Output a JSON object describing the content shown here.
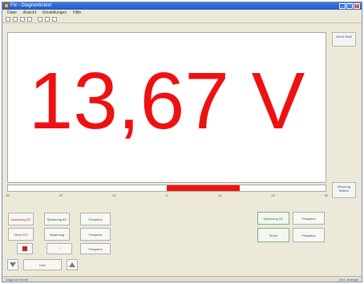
{
  "window": {
    "title": "Fix - Diagnostictest"
  },
  "menu": {
    "items": [
      "Datei",
      "Ansicht",
      "Einstellungen",
      "Hilfe"
    ]
  },
  "reading": {
    "value": "13,67 V"
  },
  "side_buttons": {
    "top": "Menü Multi",
    "bottom": "Messung Balken"
  },
  "bargraph": {
    "fill_start_fraction": 0.5,
    "fill_end_fraction": 0.73,
    "color": "#ee1111",
    "ticks": [
      "-30",
      "-20",
      "-10",
      "0",
      "10",
      "20",
      "30"
    ]
  },
  "buttons": {
    "r1c1": "Spannung DC",
    "r1c2": "Spannung AC",
    "r1c3": "Frequenz",
    "r2c1": "Strom DC",
    "r2c2": "Spannung",
    "r2c3": "Frequenz",
    "r3c3": "Frequenz",
    "center": "Hold",
    "rg1": "Spannung DC",
    "rg2": "Frequenz",
    "rg3": "Strom",
    "rg4": "Frequenz"
  },
  "status": {
    "left": "Diagnose bereit",
    "right": "Dez. Anzeige"
  },
  "colors": {
    "accent": "#ee1111",
    "titlebar": "#1e56c8"
  }
}
